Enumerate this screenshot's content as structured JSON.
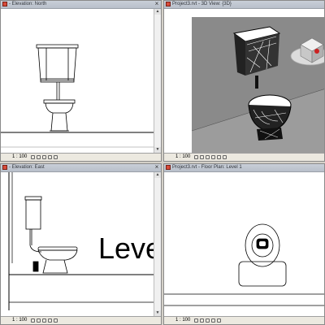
{
  "windows": {
    "north": {
      "title": "- Elevation: North",
      "scale": "1 : 100"
    },
    "three_d": {
      "title": "Project3.rvt - 3D View: {3D}",
      "scale": "1 : 100"
    },
    "east": {
      "title": "- Elevation: East",
      "scale": "1 : 100",
      "level_text": "Leve"
    },
    "floor_plan": {
      "title": "Project3.rvt - Floor Plan: Level 1",
      "scale": "1 : 100"
    }
  },
  "icons": [
    "revit-app-icon",
    "close-icon",
    "scroll-up-icon",
    "scroll-down-icon",
    "view-control-icon"
  ],
  "colors": {
    "titlebar": "#c0c6d0",
    "background_3d": "#8c8c8c",
    "selection_highlight": "#cc2222"
  }
}
